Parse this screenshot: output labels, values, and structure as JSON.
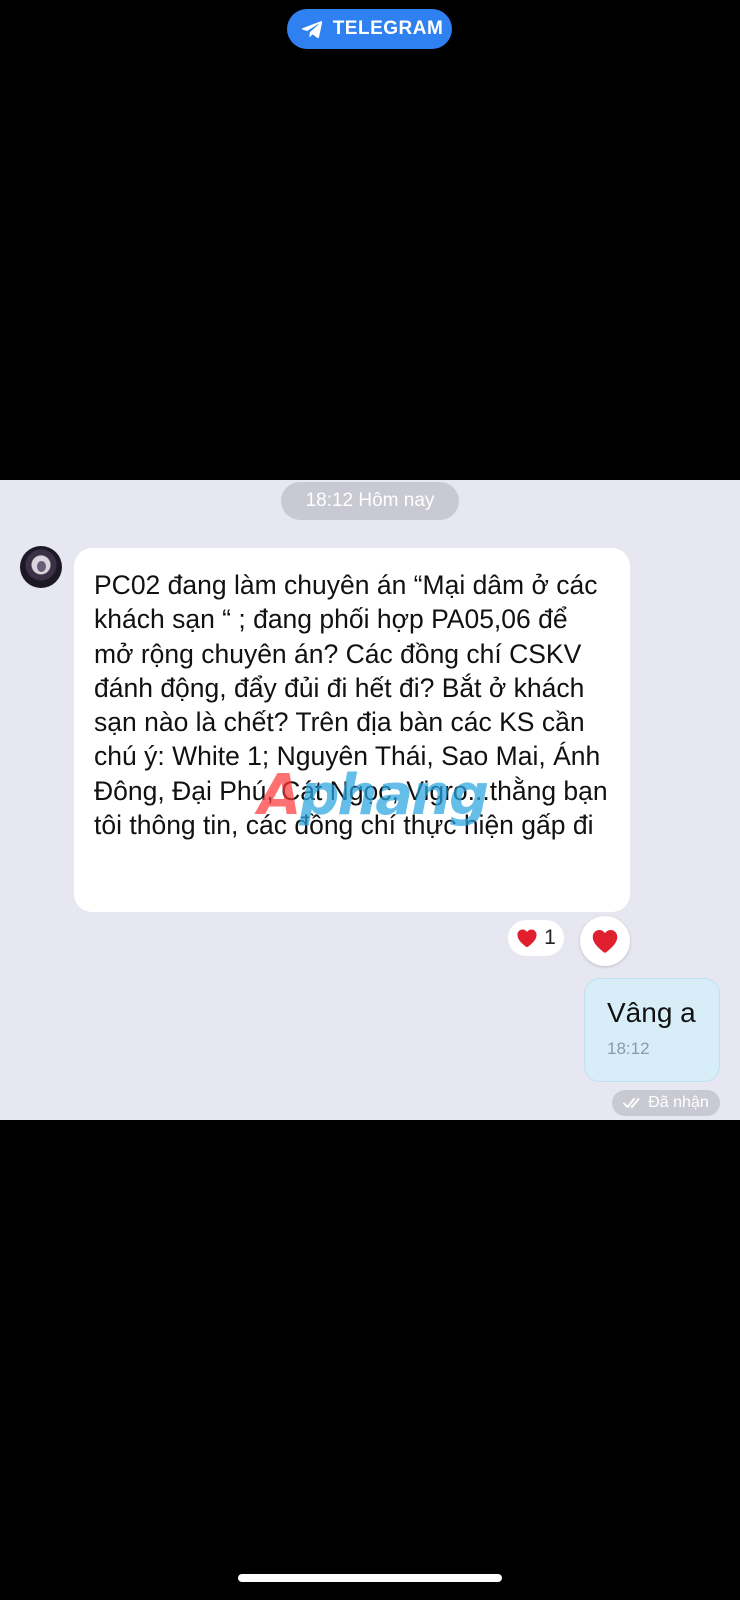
{
  "header": {
    "app_label": "TELEGRAM",
    "icon": "telegram-paper-plane-icon"
  },
  "chat": {
    "date_chip": "18:12 Hôm nay",
    "incoming": {
      "avatar_icon": "avatar",
      "text": "PC02 đang làm chuyên án “Mại dâm ở các khách sạn “ ; đang phối hợp PA05,06 để mở rộng chuyên án? Các đồng chí CSKV đánh động, đẩy đủi đi hết đi? Bắt ở khách sạn nào là chết? Trên địa bàn các KS cần chú ý: White 1; Nguyên Thái, Sao Mai, Ánh Đông, Đại Phú, Cát Ngọc, Vigro...thằng bạn tôi thông tin, các đồng chí thực hiện gấp đi",
      "reaction": {
        "icon": "heart-icon",
        "count": "1"
      },
      "reaction_button_icon": "heart-icon"
    },
    "outgoing": {
      "text": "Vâng a",
      "time": "18:12",
      "status": "Đã nhận",
      "status_icon": "double-check-icon"
    },
    "watermark": {
      "first": "A",
      "rest": "phang"
    }
  },
  "colors": {
    "telegram_blue": "#2f80f0",
    "chat_background": "#e7e7f1",
    "outgoing_bubble": "#d7eef9",
    "heart_red": "#e0202e"
  }
}
